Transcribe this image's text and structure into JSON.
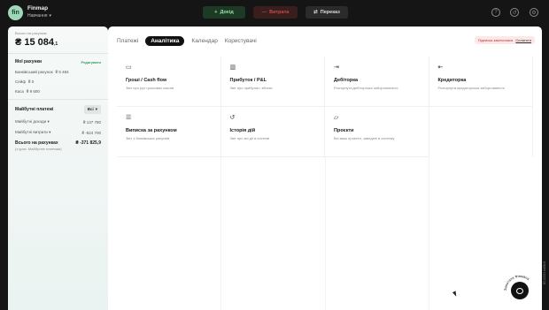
{
  "header": {
    "logo_text": "fin",
    "app_name": "Finmap",
    "workspace": "Навчання",
    "buttons": {
      "income": "Дохід",
      "expense": "Витрата",
      "transfer": "Переказ"
    },
    "icons": [
      "help-icon",
      "history-icon",
      "settings-icon"
    ]
  },
  "sidebar": {
    "total_caption": "Всього на рахунках",
    "total_value": "₴ 15 084",
    "total_fraction": ",1",
    "accounts_title": "Мої рахунки",
    "accounts_link": "Редагувати",
    "accounts": [
      {
        "name": "Банківський рахунок",
        "value": "₴ 5 484"
      },
      {
        "name": "Сейф",
        "value": "₴ 0"
      },
      {
        "name": "Каса",
        "value": "₴ 9 600"
      }
    ],
    "future_title": "Майбутні платежі",
    "future_filter": "Всі",
    "future_income_label": "Майбутні доходи",
    "future_income_value": "₴ 137 780",
    "future_expense_label": "Майбутні витрати",
    "future_expense_value": "₴ -524 700",
    "balance_label": "Всього на рахунках",
    "balance_value": "₴ -371 825",
    "balance_fraction": ",9",
    "balance_note": "(з урах. Майбутніх платежів)"
  },
  "main": {
    "tabs": [
      "Платежі",
      "Аналітика",
      "Календар",
      "Користувачі"
    ],
    "active_tab": "Аналітика",
    "subscription": {
      "text": "Підписка закінчилася",
      "pay": "Сплатити"
    },
    "cards": [
      {
        "icon": "wallet-icon",
        "glyph": "▭",
        "title": "Гроші / Cash flow",
        "desc": "Звіт про рух грошових коштів"
      },
      {
        "icon": "bar-chart-icon",
        "glyph": "▥",
        "title": "Прибуток / P&L",
        "desc": "Звіт про прибутки і збитки"
      },
      {
        "icon": "debit-in-icon",
        "glyph": "⇥",
        "title": "Дебіторка",
        "desc": "Розгорнута дебіторська заборгованість"
      },
      {
        "icon": "credit-out-icon",
        "glyph": "⇤",
        "title": "Кредиторка",
        "desc": "Розгорнута кредиторська заборгованість"
      },
      {
        "icon": "statement-icon",
        "glyph": "☰",
        "title": "Виписка за рахунком",
        "desc": "Звіт з банківських рахунків"
      },
      {
        "icon": "history-icon",
        "glyph": "↺",
        "title": "Історія дій",
        "desc": "Звіт про всі дії в системі"
      },
      {
        "icon": "folder-icon",
        "glyph": "▱",
        "title": "Проєкти",
        "desc": "Всі ваші проекти, заведені в систему"
      }
    ]
  },
  "chat": {
    "ring_text": "Запитати Фінмапа"
  },
  "build_id": "ID:1220 ed9b3"
}
